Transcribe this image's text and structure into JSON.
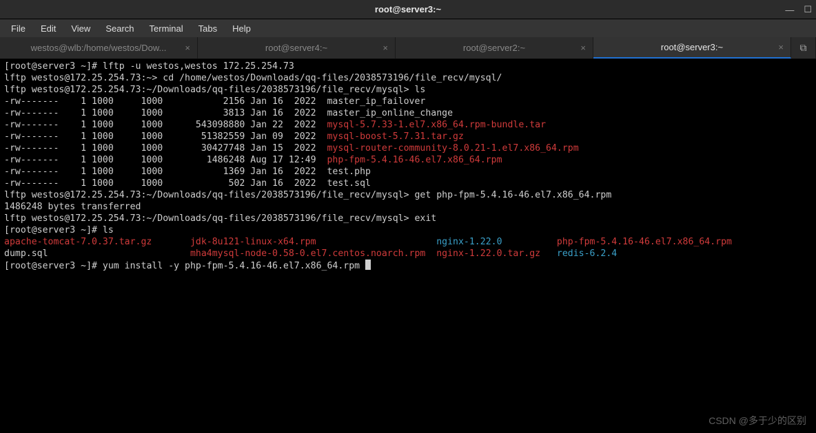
{
  "window": {
    "title": "root@server3:~",
    "controls": {
      "minimize": "—",
      "maximize": "☐"
    }
  },
  "menubar": [
    "File",
    "Edit",
    "View",
    "Search",
    "Terminal",
    "Tabs",
    "Help"
  ],
  "tabs": [
    {
      "label": "westos@wlb:/home/westos/Dow...",
      "active": false
    },
    {
      "label": "root@server4:~",
      "active": false
    },
    {
      "label": "root@server2:~",
      "active": false
    },
    {
      "label": "root@server3:~",
      "active": true
    }
  ],
  "terminal": {
    "prompt1": "[root@server3 ~]# ",
    "cmd1": "lftp -u westos,westos 172.25.254.73",
    "prompt2": "lftp westos@172.25.254.73:~> ",
    "cmd2": "cd /home/westos/Downloads/qq-files/2038573196/file_recv/mysql/",
    "prompt3": "lftp westos@172.25.254.73:~/Downloads/qq-files/2038573196/file_recv/mysql> ",
    "cmd3": "ls",
    "ls_rows": [
      {
        "perm": "-rw-------",
        "links": "1",
        "owner": "1000",
        "group": "1000",
        "size": "2156",
        "date": "Jan 16  2022",
        "name": "master_ip_failover",
        "color": ""
      },
      {
        "perm": "-rw-------",
        "links": "1",
        "owner": "1000",
        "group": "1000",
        "size": "3813",
        "date": "Jan 16  2022",
        "name": "master_ip_online_change",
        "color": ""
      },
      {
        "perm": "-rw-------",
        "links": "1",
        "owner": "1000",
        "group": "1000",
        "size": "543098880",
        "date": "Jan 22  2022",
        "name": "mysql-5.7.33-1.el7.x86_64.rpm-bundle.tar",
        "color": "red"
      },
      {
        "perm": "-rw-------",
        "links": "1",
        "owner": "1000",
        "group": "1000",
        "size": "51382559",
        "date": "Jan 09  2022",
        "name": "mysql-boost-5.7.31.tar.gz",
        "color": "red"
      },
      {
        "perm": "-rw-------",
        "links": "1",
        "owner": "1000",
        "group": "1000",
        "size": "30427748",
        "date": "Jan 15  2022",
        "name": "mysql-router-community-8.0.21-1.el7.x86_64.rpm",
        "color": "red"
      },
      {
        "perm": "-rw-------",
        "links": "1",
        "owner": "1000",
        "group": "1000",
        "size": "1486248",
        "date": "Aug 17 12:49",
        "name": "php-fpm-5.4.16-46.el7.x86_64.rpm",
        "color": "red"
      },
      {
        "perm": "-rw-------",
        "links": "1",
        "owner": "1000",
        "group": "1000",
        "size": "1369",
        "date": "Jan 16  2022",
        "name": "test.php",
        "color": ""
      },
      {
        "perm": "-rw-------",
        "links": "1",
        "owner": "1000",
        "group": "1000",
        "size": "502",
        "date": "Jan 16  2022",
        "name": "test.sql",
        "color": ""
      }
    ],
    "prompt4": "lftp westos@172.25.254.73:~/Downloads/qq-files/2038573196/file_recv/mysql> ",
    "cmd4": "get php-fpm-5.4.16-46.el7.x86_64.rpm",
    "transfer": "1486248 bytes transferred",
    "prompt5": "lftp westos@172.25.254.73:~/Downloads/qq-files/2038573196/file_recv/mysql> ",
    "cmd5": "exit",
    "prompt6": "[root@server3 ~]# ",
    "cmd6": "ls",
    "ls2": {
      "col1a": "apache-tomcat-7.0.37.tar.gz",
      "col1b": "dump.sql",
      "col2a": "jdk-8u121-linux-x64.rpm",
      "col2b": "mha4mysql-node-0.58-0.el7.centos.noarch.rpm",
      "col3a": "nginx-1.22.0",
      "col3b": "nginx-1.22.0.tar.gz",
      "col4a": "php-fpm-5.4.16-46.el7.x86_64.rpm",
      "col4b": "redis-6.2.4"
    },
    "prompt7": "[root@server3 ~]# ",
    "cmd7": "yum install -y php-fpm-5.4.16-46.el7.x86_64.rpm "
  },
  "watermark": "CSDN @多于少的区别"
}
